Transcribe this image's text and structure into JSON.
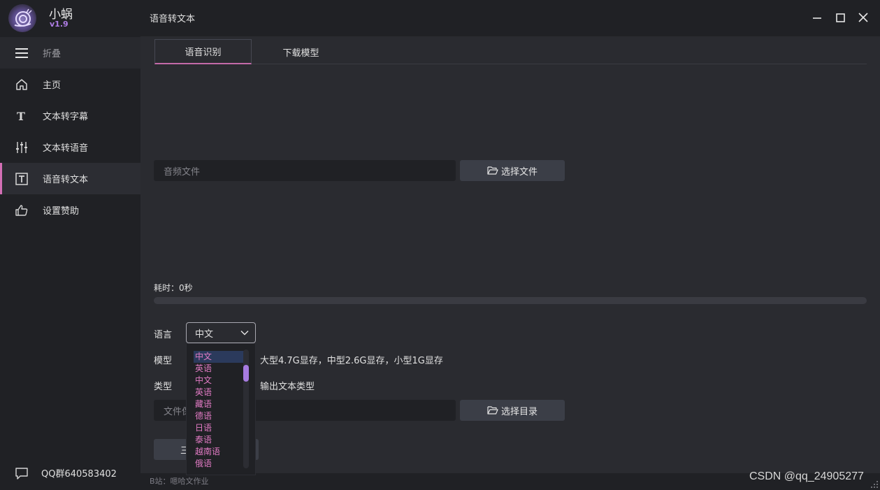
{
  "app": {
    "name": "小蜗",
    "version": "v1.9",
    "window_title": "语音转文本"
  },
  "sidebar": {
    "fold_label": "折叠",
    "items": [
      {
        "label": "主页",
        "icon": "home-icon"
      },
      {
        "label": "文本转字幕",
        "icon": "text-t-icon"
      },
      {
        "label": "文本转语音",
        "icon": "sliders-icon"
      },
      {
        "label": "语音转文本",
        "icon": "text-box-icon",
        "active": true
      },
      {
        "label": "设置赞助",
        "icon": "thumbs-up-icon"
      }
    ],
    "qq_group": "QQ群640583402"
  },
  "tabs": [
    {
      "label": "语音识别",
      "active": true
    },
    {
      "label": "下载模型",
      "active": false
    }
  ],
  "audio": {
    "placeholder": "音频文件",
    "select_file_label": "选择文件"
  },
  "progress": {
    "elapsed_label": "耗时：0秒",
    "value": 0
  },
  "form": {
    "language_label": "语言",
    "language_value": "中文",
    "model_label": "模型",
    "model_hint": "大型4.7G显存，中型2.6G显存，小型1G显存",
    "type_label": "类型",
    "type_hint": "输出文本类型",
    "dir_placeholder": "文件保",
    "select_dir_label": "选择目录",
    "start_label": "三"
  },
  "language_options": [
    "中文",
    "英语",
    "中文",
    "英语",
    "藏语",
    "德语",
    "日语",
    "泰语",
    "越南语",
    "俄语"
  ],
  "footer": {
    "text": "B站：嗯哈文作业"
  },
  "watermark": "CSDN @qq_24905277",
  "colors": {
    "accent_pink": "#c46aa8",
    "accent_purple": "#a77be0",
    "background": "#2a2b30",
    "sidebar_bg": "#202125"
  }
}
